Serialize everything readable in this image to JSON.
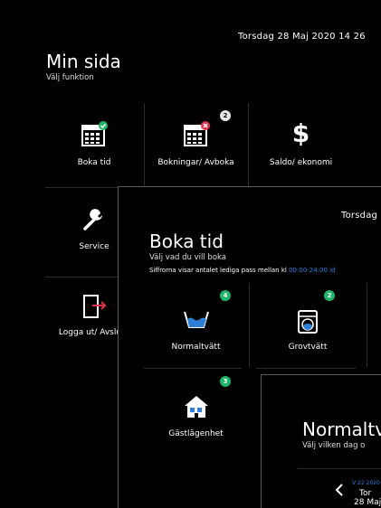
{
  "screen1": {
    "datetime": "Torsdag 28 Maj 2020   14 26",
    "title": "Min sida",
    "subtitle": "Välj funktion",
    "tiles": [
      {
        "label": "Boka tid",
        "icon": "calendar-check-icon"
      },
      {
        "label": "Bokningar/ Avboka",
        "icon": "calendar-cancel-icon",
        "badge": "2"
      },
      {
        "label": "Saldo/ ekonomi",
        "icon": "dollar-icon"
      },
      {
        "label": "Service",
        "icon": "wrench-icon"
      },
      {
        "label": "Logga ut/ Avsluta",
        "icon": "logout-icon"
      }
    ]
  },
  "screen2": {
    "datetime": "Torsdag",
    "title": "Boka tid",
    "subtitle": "Välj vad du vill boka",
    "note_prefix": "Siffrorna visar antalet lediga pass mellan kl",
    "note_range": "00:00-24:00 id",
    "tiles": [
      {
        "label": "Normaltvätt",
        "icon": "washing-tub-icon",
        "badge": "4"
      },
      {
        "label": "Grovtvätt",
        "icon": "washing-machine-icon",
        "badge": "2"
      },
      {
        "label": "Gästlägenhet",
        "icon": "house-icon",
        "badge": "3"
      }
    ]
  },
  "screen3": {
    "title": "Normaltv",
    "subtitle": "Välj vilken dag o",
    "week_label": "V 22 2020",
    "day": "Tor",
    "date": "28 Maj"
  },
  "colors": {
    "background": "#000000",
    "badge_green": "#1fb56a",
    "accent_blue": "#2f7fd8",
    "check_green": "#1fb56a",
    "cancel_red": "#e0344b"
  }
}
